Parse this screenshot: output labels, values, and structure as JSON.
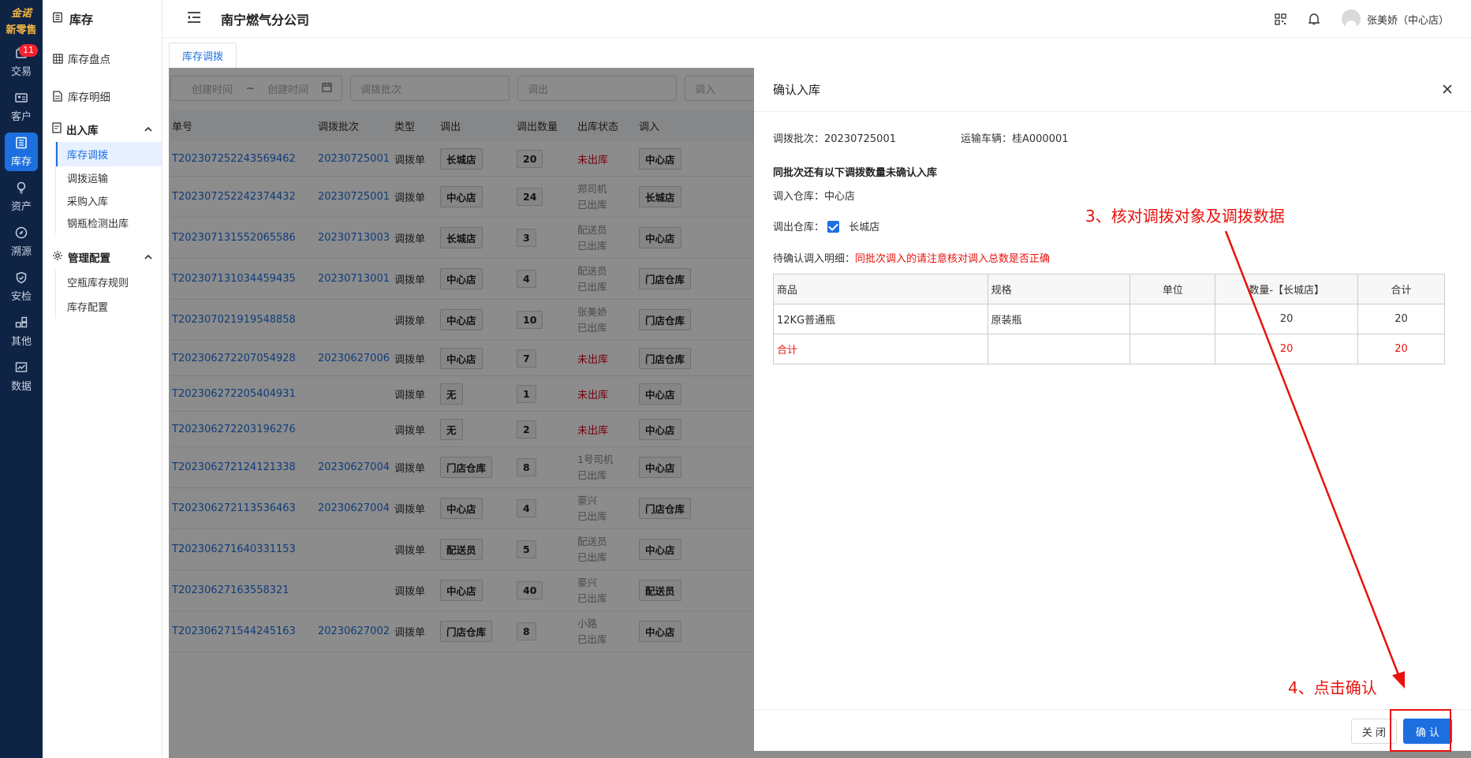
{
  "rail": {
    "logo_line1": "金诺",
    "logo_line2": "新零售",
    "items": [
      {
        "label": "交易",
        "icon": "trade-icon",
        "badge": "11"
      },
      {
        "label": "客户",
        "icon": "customer-icon"
      },
      {
        "label": "库存",
        "icon": "inventory-icon",
        "active": true
      },
      {
        "label": "资产",
        "icon": "asset-icon"
      },
      {
        "label": "溯源",
        "icon": "trace-icon"
      },
      {
        "label": "安检",
        "icon": "safety-icon"
      },
      {
        "label": "其他",
        "icon": "other-icon"
      },
      {
        "label": "数据",
        "icon": "data-icon"
      }
    ]
  },
  "sidebar": {
    "title": "库存",
    "items": {
      "stocktake": "库存盘点",
      "detail": "库存明细",
      "inout_group": "出入库",
      "transfer": "库存调拨",
      "transport": "调拨运输",
      "purchase_in": "采购入库",
      "cylinder_out": "钢瓶检测出库",
      "config_group": "管理配置",
      "empty_rule": "空瓶库存规则",
      "stock_config": "库存配置"
    }
  },
  "header": {
    "company": "南宁燃气分公司",
    "user": "张美娇（中心店）"
  },
  "tab": {
    "label": "库存调拨"
  },
  "filters": {
    "date_start": "创建时间",
    "date_sep": "~",
    "date_end": "创建时间",
    "batch": "调拨批次",
    "out": "调出",
    "in": "调入"
  },
  "table": {
    "headers": [
      "单号",
      "调拨批次",
      "类型",
      "调出",
      "调出数量",
      "出库状态",
      "调入"
    ],
    "rows": [
      {
        "no": "T202307252243569462",
        "batch": "20230725001",
        "type": "调拨单",
        "out": "长城店",
        "qty": "20",
        "status1": "未出库",
        "status2": "",
        "in": "中心店",
        "red": true
      },
      {
        "no": "T202307252242374432",
        "batch": "20230725001",
        "type": "调拨单",
        "out": "中心店",
        "qty": "24",
        "status1": "郑司机",
        "status2": "已出库",
        "in": "长城店"
      },
      {
        "no": "T202307131552065586",
        "batch": "20230713003",
        "type": "调拨单",
        "out": "长城店",
        "qty": "3",
        "status1": "配送员",
        "status2": "已出库",
        "in": "中心店"
      },
      {
        "no": "T202307131034459435",
        "batch": "20230713001",
        "type": "调拨单",
        "out": "中心店",
        "qty": "4",
        "status1": "配送员",
        "status2": "已出库",
        "in": "门店仓库"
      },
      {
        "no": "T202307021919548858",
        "batch": "",
        "type": "调拨单",
        "out": "中心店",
        "qty": "10",
        "status1": "张美娇",
        "status2": "已出库",
        "in": "门店仓库"
      },
      {
        "no": "T202306272207054928",
        "batch": "20230627006",
        "type": "调拨单",
        "out": "中心店",
        "qty": "7",
        "status1": "未出库",
        "status2": "",
        "in": "门店仓库",
        "red": true
      },
      {
        "no": "T202306272205404931",
        "batch": "",
        "type": "调拨单",
        "out": "无",
        "qty": "1",
        "status1": "未出库",
        "status2": "",
        "in": "中心店",
        "red": true
      },
      {
        "no": "T202306272203196276",
        "batch": "",
        "type": "调拨单",
        "out": "无",
        "qty": "2",
        "status1": "未出库",
        "status2": "",
        "in": "中心店",
        "red": true
      },
      {
        "no": "T202306272124121338",
        "batch": "20230627004",
        "type": "调拨单",
        "out": "门店仓库",
        "qty": "8",
        "status1": "1号司机",
        "status2": "已出库",
        "in": "中心店"
      },
      {
        "no": "T202306272113536463",
        "batch": "20230627004",
        "type": "调拨单",
        "out": "中心店",
        "qty": "4",
        "status1": "豪兴",
        "status2": "已出库",
        "in": "门店仓库"
      },
      {
        "no": "T202306271640331153",
        "batch": "",
        "type": "调拨单",
        "out": "配送员",
        "qty": "5",
        "status1": "配送员",
        "status2": "已出库",
        "in": "中心店"
      },
      {
        "no": "T20230627163558321",
        "batch": "",
        "type": "调拨单",
        "out": "中心店",
        "qty": "40",
        "status1": "豪兴",
        "status2": "已出库",
        "in": "配送员"
      },
      {
        "no": "T202306271544245163",
        "batch": "20230627002",
        "type": "调拨单",
        "out": "门店仓库",
        "qty": "8",
        "status1": "小路",
        "status2": "已出库",
        "in": "中心店"
      }
    ]
  },
  "drawer": {
    "title": "确认入库",
    "batch_label": "调拨批次：20230725001",
    "vehicle_label": "运输车辆：桂A000001",
    "notice": "同批次还有以下调拨数量未确认入库",
    "in_warehouse": "调入仓库：中心店",
    "out_warehouse_label": "调出仓库：",
    "out_warehouse_value": "长城店",
    "detail_label": "待确认调入明细：",
    "detail_warning": "同批次调入的请注意核对调入总数是否正确",
    "table_headers": [
      "商品",
      "规格",
      "单位",
      "数量-【长城店】",
      "合计"
    ],
    "rows": [
      {
        "product": "12KG普通瓶",
        "spec": "原装瓶",
        "unit": "",
        "qty": "20",
        "total": "20"
      }
    ],
    "sum_row": {
      "label": "合计",
      "qty": "20",
      "total": "20"
    },
    "close_button": "关 闭",
    "confirm_button": "确 认"
  },
  "annotations": {
    "step3": "3、核对调拨对象及调拨数据",
    "step4": "4、点击确认",
    "color": "#e8120c"
  }
}
